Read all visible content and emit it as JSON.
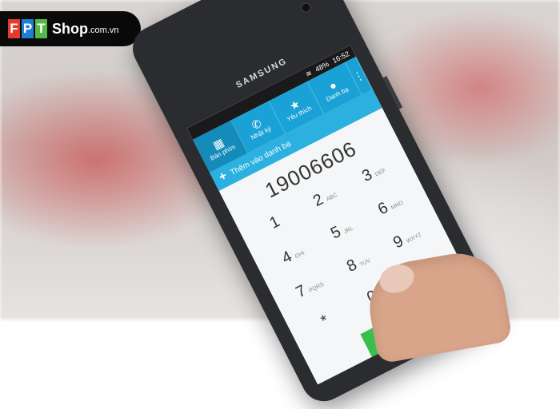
{
  "logo": {
    "f1": "F",
    "f2": "P",
    "f3": "T",
    "shop": "Shop",
    "domain": ".com.vn"
  },
  "phone": {
    "brand": "SAMSUNG",
    "status": {
      "battery": "48%",
      "time": "16:52"
    },
    "tabs": [
      {
        "label": "Bàn phím",
        "icon": "keypad-icon"
      },
      {
        "label": "Nhật ký",
        "icon": "call-log-icon"
      },
      {
        "label": "Yêu thích",
        "icon": "star-icon"
      },
      {
        "label": "Danh bạ",
        "icon": "contacts-icon"
      }
    ],
    "add_contact": "Thêm vào danh bạ",
    "number": "19006606",
    "keys": [
      {
        "d": "1",
        "l": ""
      },
      {
        "d": "2",
        "l": "ABC"
      },
      {
        "d": "3",
        "l": "DEF"
      },
      {
        "d": "4",
        "l": "GHI"
      },
      {
        "d": "5",
        "l": "JKL"
      },
      {
        "d": "6",
        "l": "MNO"
      },
      {
        "d": "7",
        "l": "PQRS"
      },
      {
        "d": "8",
        "l": "TUV"
      },
      {
        "d": "9",
        "l": "WXYZ"
      },
      {
        "d": "*",
        "l": ""
      },
      {
        "d": "0",
        "l": "+"
      },
      {
        "d": "#",
        "l": ""
      }
    ]
  }
}
